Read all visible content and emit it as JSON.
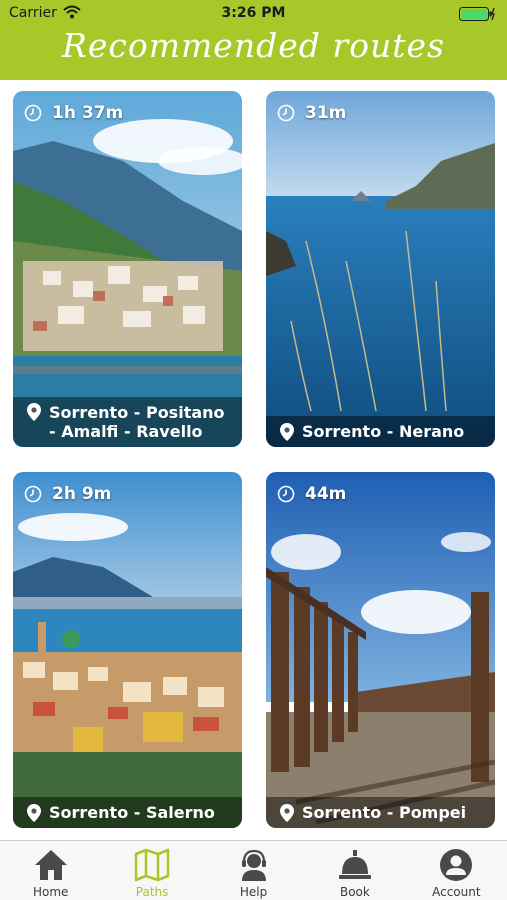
{
  "status_bar": {
    "carrier": "Carrier",
    "time": "3:26 PM"
  },
  "header": {
    "title": "Recommended routes",
    "color": "#a8c82a"
  },
  "routes": [
    {
      "duration": "1h 37m",
      "line1": "Sorrento - Positano",
      "line2": "- Amalfi - Ravello"
    },
    {
      "duration": "31m",
      "line1": "Sorrento - Nerano"
    },
    {
      "duration": "2h 9m",
      "line1": "Sorrento - Salerno"
    },
    {
      "duration": "44m",
      "line1": "Sorrento - Pompei"
    }
  ],
  "tabs": [
    {
      "label": "Home",
      "icon": "home-icon"
    },
    {
      "label": "Paths",
      "icon": "map-icon",
      "active": true
    },
    {
      "label": "Help",
      "icon": "headset-icon"
    },
    {
      "label": "Book",
      "icon": "bell-icon"
    },
    {
      "label": "Account",
      "icon": "user-icon"
    }
  ]
}
